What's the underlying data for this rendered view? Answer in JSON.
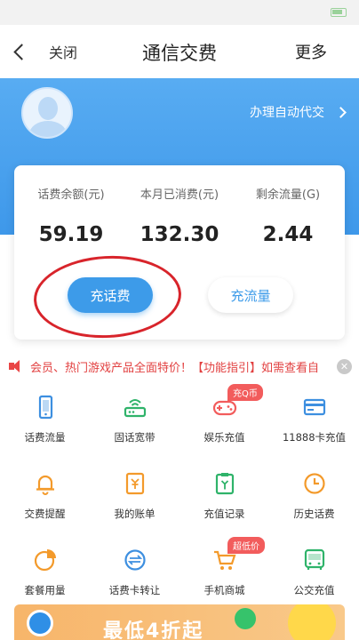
{
  "nav": {
    "close_label": "关闭",
    "title": "通信交费",
    "more_label": "更多"
  },
  "hero": {
    "auto_pay_label": "办理自动代交"
  },
  "account": {
    "stats": [
      {
        "label": "话费余额(元)",
        "value": "59.19"
      },
      {
        "label": "本月已消费(元)",
        "value": "132.30"
      },
      {
        "label": "剩余流量(G)",
        "value": "2.44"
      }
    ],
    "recharge_bill_label": "充话费",
    "recharge_data_label": "充流量"
  },
  "notice": {
    "text": "会员、热门游戏产品全面特价！【功能指引】如需查看自"
  },
  "services": [
    {
      "label": "话费流量",
      "icon": "phone-icon"
    },
    {
      "label": "固话宽带",
      "icon": "router-icon"
    },
    {
      "label": "娱乐充值",
      "icon": "gamepad-icon",
      "tag": "充Q币"
    },
    {
      "label": "11888卡充值",
      "icon": "card-icon"
    },
    {
      "label": "交费提醒",
      "icon": "bell-icon"
    },
    {
      "label": "我的账单",
      "icon": "bill-icon"
    },
    {
      "label": "充值记录",
      "icon": "record-icon"
    },
    {
      "label": "历史话费",
      "icon": "clock-icon"
    },
    {
      "label": "套餐用量",
      "icon": "pie-icon"
    },
    {
      "label": "话费卡转让",
      "icon": "transfer-icon"
    },
    {
      "label": "手机商城",
      "icon": "cart-icon",
      "tag": "超低价"
    },
    {
      "label": "公交充值",
      "icon": "bus-icon"
    }
  ],
  "banner": {
    "text": "最低4折起"
  },
  "colors": {
    "primary": "#3d9be9",
    "icon_green": "#2fb36a",
    "icon_orange": "#f39a2b",
    "icon_blue": "#3d8fe0",
    "icon_red": "#f25c5c",
    "notice_red": "#e24040",
    "annotation_red": "#d8242b"
  }
}
